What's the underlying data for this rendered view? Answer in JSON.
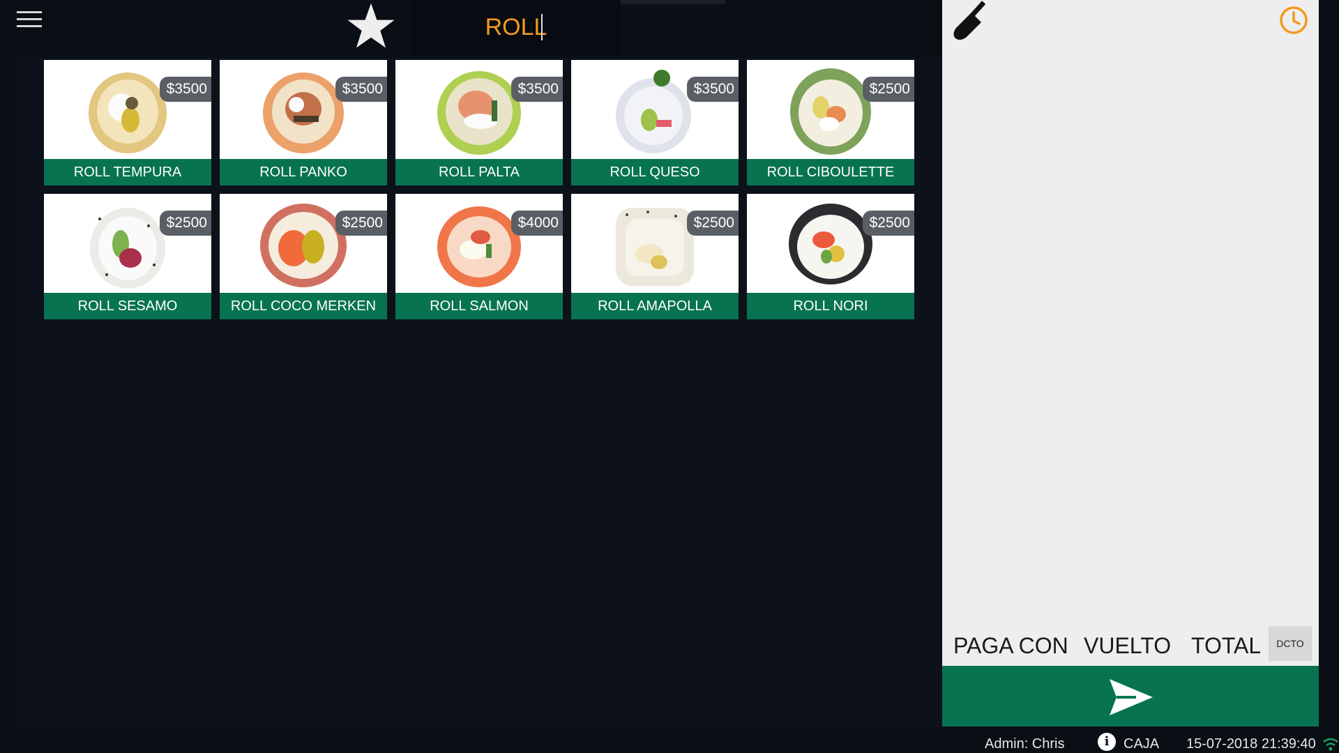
{
  "header": {
    "search": {
      "value": "ROLL",
      "placeholder": ""
    }
  },
  "products": [
    {
      "name": "ROLL TEMPURA",
      "price": "$3500",
      "image": "sushi-roll-tempura"
    },
    {
      "name": "ROLL PANKO",
      "price": "$3500",
      "image": "sushi-roll-panko"
    },
    {
      "name": "ROLL PALTA",
      "price": "$3500",
      "image": "sushi-roll-palta"
    },
    {
      "name": "ROLL QUESO",
      "price": "$3500",
      "image": "sushi-roll-queso"
    },
    {
      "name": "ROLL CIBOULETTE",
      "price": "$2500",
      "image": "sushi-roll-ciboulette"
    },
    {
      "name": "ROLL SESAMO",
      "price": "$2500",
      "image": "sushi-roll-sesamo"
    },
    {
      "name": "ROLL COCO MERKEN",
      "price": "$2500",
      "image": "sushi-roll-coco-merken"
    },
    {
      "name": "ROLL SALMON",
      "price": "$4000",
      "image": "sushi-roll-salmon"
    },
    {
      "name": "ROLL AMAPOLLA",
      "price": "$2500",
      "image": "sushi-roll-amapolla"
    },
    {
      "name": "ROLL NORI",
      "price": "$2500",
      "image": "sushi-roll-nori"
    }
  ],
  "order_panel": {
    "paga_con_label": "PAGA CON",
    "vuelto_label": "VUELTO",
    "total_label": "TOTAL",
    "dcto_label": "DCTO"
  },
  "status_bar": {
    "user": "Admin: Chris",
    "mode": "CAJA",
    "datetime": "15-07-2018 21:39:40"
  },
  "colors": {
    "accent_green": "#077350",
    "search_text": "#f39a1c",
    "clock_icon": "#f39a1c",
    "background_dark": "#0b0f18",
    "panel_light": "#eeeeee"
  },
  "icons": [
    "menu-icon",
    "star-icon",
    "broom-icon",
    "clock-icon",
    "send-icon",
    "info-icon",
    "wifi-icon"
  ]
}
